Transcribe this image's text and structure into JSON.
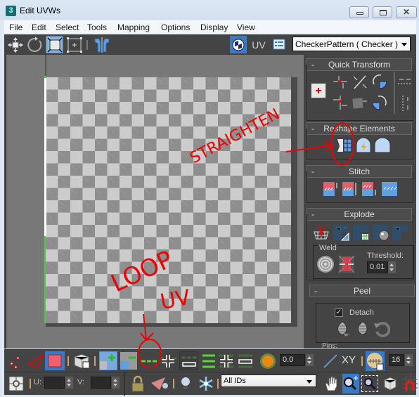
{
  "window": {
    "title": "Edit UVWs",
    "controls": {
      "minimize": "minimize",
      "maximize": "maximize",
      "close": "close"
    }
  },
  "menu": [
    "File",
    "Edit",
    "Select",
    "Tools",
    "Mapping",
    "Options",
    "Display",
    "View"
  ],
  "top_toolbar": {
    "tools": [
      "move-icon",
      "rotate-icon",
      "scale-icon",
      "freeform-icon",
      "mirror-icon"
    ],
    "uv_label": "UV",
    "texture_dropdown": "CheckerPattern  ( Checker )"
  },
  "rollouts": {
    "quick_transform": {
      "title": "Quick Transform",
      "toggle": "-"
    },
    "reshape_elements": {
      "title": "Reshape Elements",
      "toggle": "-"
    },
    "stitch": {
      "title": "Stitch",
      "toggle": "-"
    },
    "explode": {
      "title": "Explode",
      "toggle": "-",
      "weld_label": "Weld",
      "threshold_label": "Threshold:",
      "threshold_value": "0.01"
    },
    "peel": {
      "title": "Peel",
      "toggle": "-",
      "detach_label": "Detach",
      "detach_checked": true,
      "pins_label": "Pins:"
    }
  },
  "bottom_toolbar": {
    "soft_selection_value": "0.0",
    "xy_label": "XY",
    "grid_value": "16",
    "u_label": "U:",
    "v_label": "V:",
    "u_value": "",
    "v_value": "",
    "id_filter": "All IDs"
  },
  "annotations": {
    "straighten": "STRAIGHTEN",
    "loop": "LOOP",
    "uv": "UV",
    "color": "#ee0000"
  },
  "colors": {
    "panel_bg": "#444444",
    "viewport_bg": "#787878",
    "checker_light": "#cccccc",
    "checker_dark": "#8e8e8e",
    "active_blue": "#3a78c8",
    "selection_green": "#3dd33d"
  }
}
